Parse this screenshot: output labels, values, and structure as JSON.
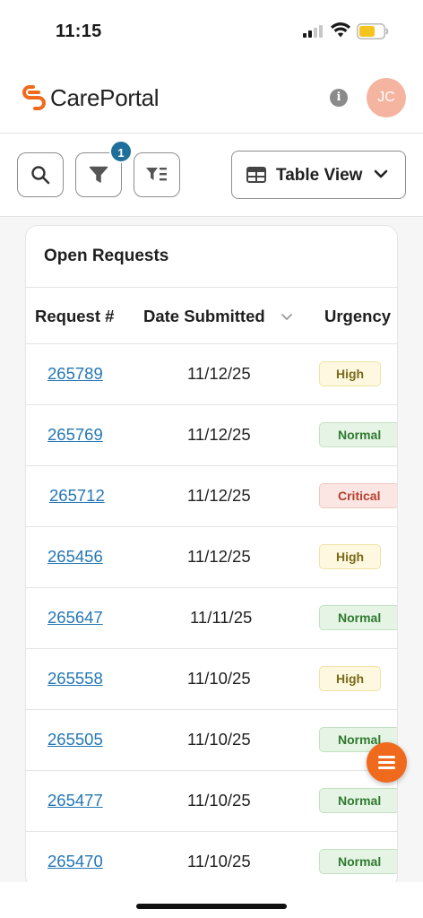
{
  "status_bar": {
    "time": "11:15"
  },
  "header": {
    "app_name": "CarePortal",
    "avatar_initials": "JC",
    "brand_color": "#f06a1d"
  },
  "toolbar": {
    "filter_count": "1",
    "view_label": "Table View"
  },
  "card": {
    "title": "Open Requests"
  },
  "table": {
    "columns": {
      "request": "Request #",
      "date": "Date Submitted",
      "urgency": "Urgency"
    },
    "rows": [
      {
        "request": "265789",
        "date": "11/12/25",
        "urgency": "High"
      },
      {
        "request": "265769",
        "date": "11/12/25",
        "urgency": "Normal"
      },
      {
        "request": "265712",
        "date": "11/12/25",
        "urgency": "Critical"
      },
      {
        "request": "265456",
        "date": "11/12/25",
        "urgency": "High"
      },
      {
        "request": "265647",
        "date": "11/11/25",
        "urgency": "Normal"
      },
      {
        "request": "265558",
        "date": "11/10/25",
        "urgency": "High"
      },
      {
        "request": "265505",
        "date": "11/10/25",
        "urgency": "Normal"
      },
      {
        "request": "265477",
        "date": "11/10/25",
        "urgency": "Normal"
      },
      {
        "request": "265470",
        "date": "11/10/25",
        "urgency": "Normal"
      }
    ]
  },
  "icons": {
    "search": "search-icon",
    "filter": "filter-icon",
    "sort_filter": "filter-list-icon",
    "view": "table-grid-icon",
    "menu": "menu-icon"
  }
}
